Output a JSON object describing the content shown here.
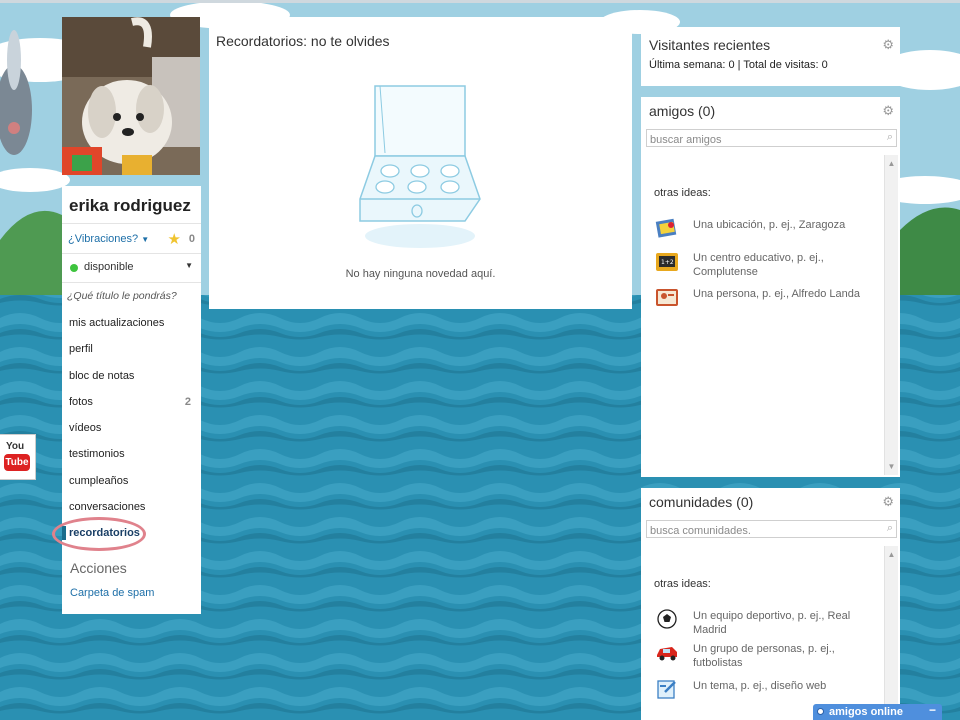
{
  "profile": {
    "name": "erika rodriguez",
    "vibes_label": "¿Vibraciones?",
    "star_count": "0",
    "status": "disponible",
    "title_prompt": "¿Qué título le pondrás?"
  },
  "nav": [
    {
      "label": "mis actualizaciones",
      "count": ""
    },
    {
      "label": "perfil",
      "count": ""
    },
    {
      "label": "bloc de notas",
      "count": ""
    },
    {
      "label": "fotos",
      "count": "2"
    },
    {
      "label": "vídeos",
      "count": ""
    },
    {
      "label": "testimonios",
      "count": ""
    },
    {
      "label": "cumpleaños",
      "count": ""
    },
    {
      "label": "conversaciones",
      "count": ""
    },
    {
      "label": "recordatorios",
      "count": "",
      "active": true
    }
  ],
  "actions": {
    "heading": "Acciones",
    "spam": "Carpeta de spam"
  },
  "youtube": {
    "you": "You",
    "tube": "Tube"
  },
  "reminders": {
    "title": "Recordatorios: no te olvides",
    "empty": "No hay ninguna novedad aquí."
  },
  "visitors": {
    "title": "Visitantes recientes",
    "summary": "Última semana: 0 | Total de visitas: 0"
  },
  "friends": {
    "title": "amigos (0)",
    "search_placeholder": "buscar amigos",
    "ideas_label": "otras ideas:",
    "ideas": [
      {
        "icon": "location-icon",
        "text": "Una ubicación, p. ej., Zaragoza"
      },
      {
        "icon": "school-icon",
        "text": "Un centro educativo, p. ej., Complutense"
      },
      {
        "icon": "person-card-icon",
        "text": "Una persona, p. ej., Alfredo Landa"
      }
    ]
  },
  "communities": {
    "title": "comunidades (0)",
    "search_placeholder": "busca comunidades.",
    "ideas_label": "otras ideas:",
    "ideas": [
      {
        "icon": "soccer-ball-icon",
        "text": "Un equipo deportivo, p. ej., Real Madrid"
      },
      {
        "icon": "red-car-icon",
        "text": "Un grupo de personas, p. ej., futbolistas"
      },
      {
        "icon": "topic-icon",
        "text": "Un tema, p. ej., diseño web"
      }
    ]
  },
  "online": {
    "label": "amigos online",
    "minimize": "−"
  },
  "colors": {
    "link": "#1d6fa8",
    "status_online": "#3ec43e",
    "highlight": "#e0828c",
    "chat_bar": "#4f8fdd"
  }
}
